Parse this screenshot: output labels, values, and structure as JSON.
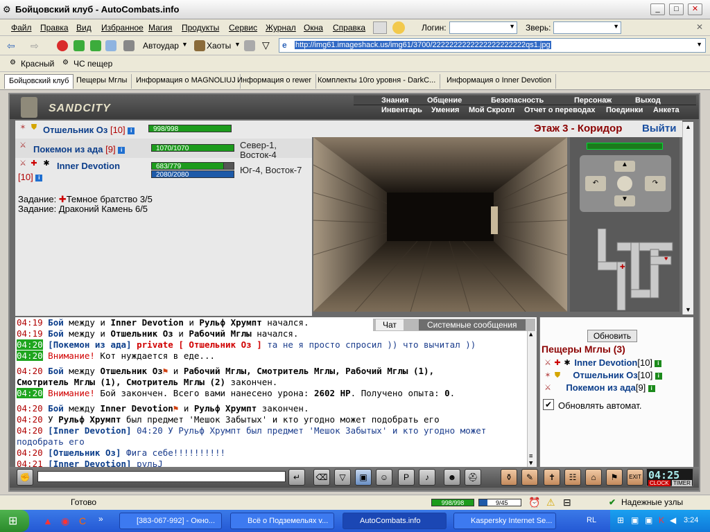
{
  "window": {
    "title": "Бойцовский клуб - AutoCombats.info"
  },
  "menu": {
    "items": [
      "Файл",
      "Правка",
      "Вид",
      "Избранное",
      "Магия",
      "Продукты",
      "Сервис",
      "Журнал",
      "Окна",
      "Справка"
    ],
    "login_label": "Логин:",
    "beast_label": "Зверь:"
  },
  "toolbar": {
    "autoudar": "Автоудар",
    "haoty": "Хаоты",
    "address": "http://img61.imageshack.us/img61/3700/2222222222222222222222qs1.jpg"
  },
  "links": {
    "items": [
      "Красный",
      "ЧС пещер"
    ]
  },
  "tabs": [
    "Бойцовский клуб",
    "Пещеры Мглы",
    "Информация о MAGNOLIUJ",
    "Информация о rewer",
    "Комплекты 10го уровня - DarkC...",
    "Информация о Inner Devotion"
  ],
  "game": {
    "logo": "SANDCITY",
    "nav_top": [
      "Знания",
      "Общение",
      "Безопасность",
      "Персонаж",
      "Выход"
    ],
    "nav_bottom": [
      "Инвентарь",
      "Умения",
      "Мой Скролл",
      "Отчет о переводах",
      "Поединки",
      "Анкета"
    ],
    "location": "Этаж 3 - Коридор",
    "exit": "Выйти",
    "players": [
      {
        "name": "Отшельник Оз",
        "level": "[10]",
        "hp": "998/998",
        "hp_frac": 1.0
      },
      {
        "name": "Покемон из ада",
        "level": "[9]",
        "hp": "1070/1070",
        "hp_frac": 1.0,
        "pos1": "Север-1,",
        "pos2": "Восток-4"
      },
      {
        "name": "Inner Devotion",
        "level": "[10]",
        "hp": "683/779",
        "hp_frac": 0.877,
        "mp": "2080/2080",
        "pos": "Юг-4, Восток-7"
      }
    ],
    "task1": "Задание: ",
    "task1b": "Темное братство 3/5",
    "task2": "Задание: Драконий Камень 6/5"
  },
  "chat": {
    "tabs": [
      "Чат",
      "Системные сообщения"
    ],
    "lines": [
      {
        "t": "04:19",
        "a": "Бой",
        "b": " между и ",
        "c": "Inner Devotion",
        "d": " и ",
        "e": "Рульф Хрумпт",
        "f": " начался."
      },
      {
        "t": "04:19",
        "a": "Бой",
        "b": " между и ",
        "c": "Отшельник Оз",
        "d": " и ",
        "e": "Рабочий Мглы",
        "f": " начался."
      },
      {
        "t": "04:20",
        "pre": "[Покемон из ада]",
        "priv": " private [ Отшельник Оз ]",
        "msg": " та не я просто спросил )) что вычитал ))"
      },
      {
        "t": "04:20",
        "att": "Внимание!",
        "msg": " Кот нуждается в еде..."
      },
      {
        "t": "04:20",
        "a": "Бой",
        "b": " между ",
        "c": "Отшельник Оз",
        "d": " и ",
        "e": "Рабочий Мглы, Смотритель Мглы, Рабочий Мглы (1),"
      },
      {
        "cont": "Смотритель Мглы (1), Смотритель Мглы (2)",
        "tail": " закончен."
      },
      {
        "t": "04:20",
        "att": "Внимание!",
        "msg": " Бой закончен. Всего вами нанесено урона: ",
        "dmg": "2602 HP",
        "msg2": ". Получено опыта: ",
        "exp": "0",
        "msg3": "."
      },
      {
        "t": "04:20",
        "a": "Бой",
        "b": " между ",
        "c": "Inner Devotion",
        "d": " и ",
        "e": "Рульф Хрумпт",
        "f": " закончен."
      },
      {
        "t": "04:20",
        "u": " У ",
        "n": "Рульф Хрумпт",
        "msg": " был предмет 'Мешок Забытых' и кто угодно может подобрать его"
      },
      {
        "t": "04:20",
        "pre": "[Inner Devotion]",
        "msg": " 04:20 У Рульф Хрумпт был предмет 'Мешок Забытых' и кто угодно может"
      },
      {
        "cont2": "подобрать его"
      },
      {
        "t": "04:20",
        "pre": "[Отшельник Оз]",
        "msg": " Фига себе!!!!!!!!!!"
      },
      {
        "t": "04:21",
        "pre": "[Inner Devotion]",
        "msg": " рульJ"
      }
    ]
  },
  "right": {
    "refresh": "Обновить",
    "location": "Пещеры Мглы (3)",
    "players": [
      {
        "name": "Inner Devotion",
        "level": "[10]"
      },
      {
        "name": "Отшельник Оз",
        "level": "[10]"
      },
      {
        "name": "Покемон из ада",
        "level": "[9]"
      }
    ],
    "auto": "Обновлять автомат."
  },
  "clock": {
    "time": "04:25",
    "clock_label": "CLOCK",
    "timer_label": "TIMER"
  },
  "status": {
    "text": "Готово",
    "hp": "998/998",
    "mp": "9/45",
    "zone": "Надежные узлы"
  },
  "taskbar": {
    "items": [
      "[383-067-992] - Окно...",
      "Всё о Подземельях  v...",
      "AutoCombats.info",
      "Kaspersky Internet Se..."
    ],
    "lang": "RL",
    "time": "3:24"
  }
}
